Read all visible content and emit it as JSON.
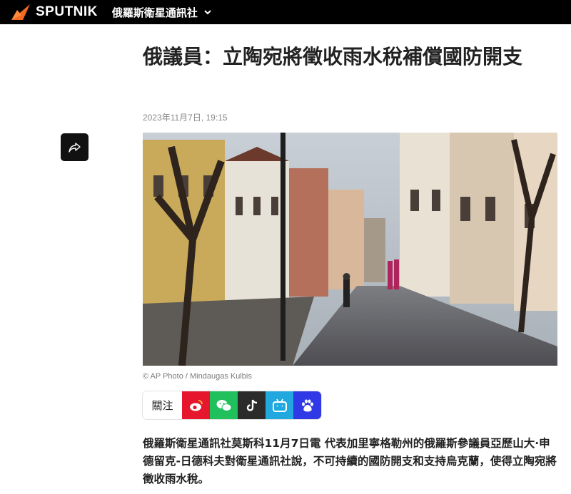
{
  "header": {
    "brand": "SPUTNIK",
    "section": "俄羅斯衛星通訊社",
    "icons": [
      "sputnik-logo-icon",
      "chevron-down-icon"
    ],
    "colors": {
      "bar": "#000000",
      "logo_accent": "#f26a21"
    }
  },
  "share": {
    "icon": "share-arrow-icon"
  },
  "article": {
    "title": "俄議員：立陶宛將徵收雨水稅補償國防開支",
    "date": "2023年11月7日, 19:15",
    "photo_caption": "© AP Photo / Mindaugas Kulbis",
    "lead": "俄羅斯衛星通訊社莫斯科11月7日電 代表加里寧格勒州的俄羅斯參議員亞歷山大·申德留克-日德科夫對衛星通訊社說，不可持續的國防開支和支持烏克蘭，使得立陶宛將徵收雨水稅。"
  },
  "social": {
    "follow_label": "關注",
    "buttons": [
      {
        "name": "weibo",
        "icon": "weibo-icon",
        "color": "#e6162d"
      },
      {
        "name": "wechat",
        "icon": "wechat-icon",
        "color": "#20c05c"
      },
      {
        "name": "tiktok",
        "icon": "tiktok-icon",
        "color": "#2b2b2b"
      },
      {
        "name": "bilibili",
        "icon": "bilibili-icon",
        "color": "#20a8df"
      },
      {
        "name": "baidu",
        "icon": "baidu-icon",
        "color": "#2f39e5"
      }
    ]
  }
}
